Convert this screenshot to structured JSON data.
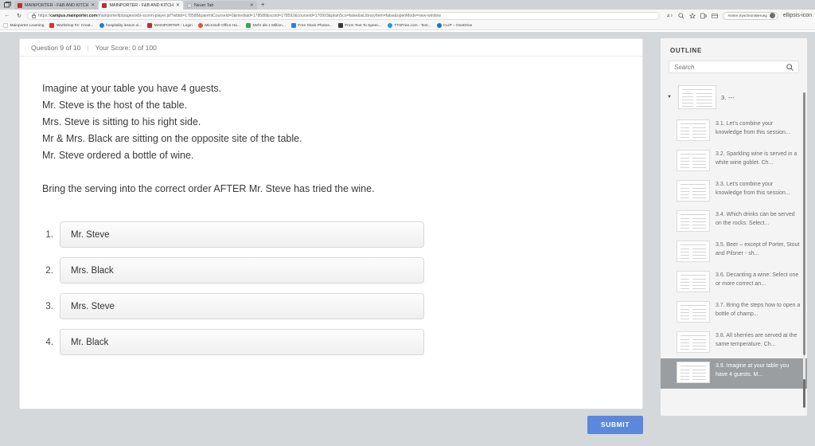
{
  "browser": {
    "system_menu_icon": "window-restore-icon",
    "tabs": [
      {
        "title": "MAINPORTER - F&B AND KITCH",
        "favicon": "mainporter-favicon",
        "active": false,
        "close_label": "✕"
      },
      {
        "title": "MAINPORTER - F&B AND KITCH",
        "favicon": "mainporter-favicon",
        "active": true,
        "close_label": "✕"
      },
      {
        "title": "Neuer Tab",
        "favicon": "page-favicon",
        "active": false,
        "close_label": "✕"
      }
    ],
    "new_tab_label": "+",
    "nav": {
      "back": "←",
      "refresh": "↻"
    },
    "omnibox": {
      "lock_icon": "lock-icon",
      "url_prefix": "https://",
      "url_domain": "campus.mainporter.com",
      "url_path": "/mainporterllp/pages/wbt-scorm-player.jsf?wbtid=178588&parentCourseId=0&mediaid=178588&scoid=178592&courseid=170993&plainSco=false&isLibraryItem=false&openMode=new-window"
    },
    "toolbar_icons": [
      "read-aloud-icon",
      "zoom-icon",
      "favorites-star-icon",
      "collections-icon",
      "browser-essentials-icon"
    ],
    "profile": {
      "label": "Keine Synchronisierung",
      "avatar_icon": "avatar-icon"
    },
    "more_icon": "ellipsis-icon",
    "bookmarks": [
      {
        "label": "Mainporter Learning",
        "color": "#ffffff"
      },
      {
        "label": "Workshop #1: Creat...",
        "color": "#e02f2f"
      },
      {
        "label": "hospitality lesson vi...",
        "color": "#1c7ed6"
      },
      {
        "label": "MAINPORTER - Login",
        "color": "#b53039"
      },
      {
        "label": "Microsoft Office Ha...",
        "color": "#e8502b"
      },
      {
        "label": "Mehr als 1 Million...",
        "color": "#34a853"
      },
      {
        "label": "Free Stock Photos...",
        "color": "#2f82d8"
      },
      {
        "label": "From Text To Speec...",
        "color": "#3b3b3b"
      },
      {
        "label": "TTSFree.com - Text...",
        "color": "#2196f3"
      },
      {
        "label": "CLIP – OneDrive",
        "color": "#1a73c7"
      }
    ]
  },
  "quiz": {
    "question_counter": "Question 9 of 10",
    "separator": "|",
    "score": "Your Score: 0 of 100",
    "prompt_lines": [
      "Imagine at your table you have 4 guests.",
      "Mr. Steve is the host of the table.",
      "Mrs. Steve is sitting to his right side.",
      "Mr & Mrs. Black are sitting on the opposite site of the table.",
      "Mr. Steve ordered a bottle of wine.",
      "",
      "Bring the serving into the correct order AFTER Mr. Steve has tried the wine."
    ],
    "answers": [
      {
        "number": "1.",
        "text": "Mr. Steve"
      },
      {
        "number": "2.",
        "text": "Mrs. Black"
      },
      {
        "number": "3.",
        "text": "Mrs. Steve"
      },
      {
        "number": "4.",
        "text": "Mr. Black"
      }
    ],
    "submit_label": "SUBMIT",
    "submit_color": "#5b87dd"
  },
  "outline": {
    "title": "OUTLINE",
    "search": {
      "placeholder": "Search",
      "value": "",
      "icon": "search-icon"
    },
    "root": {
      "caret_icon": "chevron-down-icon",
      "label": "3. ---",
      "thumbnail": "slide-thumbnail"
    },
    "items": [
      {
        "label": "3.1. Let's combine your knowledge from this session...",
        "active": false
      },
      {
        "label": "3.2. Sparkling wine is served in a white wine goblet. Ch...",
        "active": false
      },
      {
        "label": "3.3. Let's combine your knowledge from this session...",
        "active": false
      },
      {
        "label": "3.4. Which drinks can be served on the rocks: Select...",
        "active": false
      },
      {
        "label": "3.5. Beer – except of Porter, Stout and Pilsner - sh...",
        "active": false
      },
      {
        "label": "3.6. Decanting a wine: Select one or more correct an...",
        "active": false
      },
      {
        "label": "3.7. Bring the steps how to open a bottle of champ...",
        "active": false
      },
      {
        "label": "3.8. All sherries are served at the same temperature. Ch...",
        "active": false
      },
      {
        "label": "3.9. Imagine at your table you have 4 guests. M...",
        "active": true
      }
    ],
    "active_highlight_color": "#9a9ea1"
  }
}
